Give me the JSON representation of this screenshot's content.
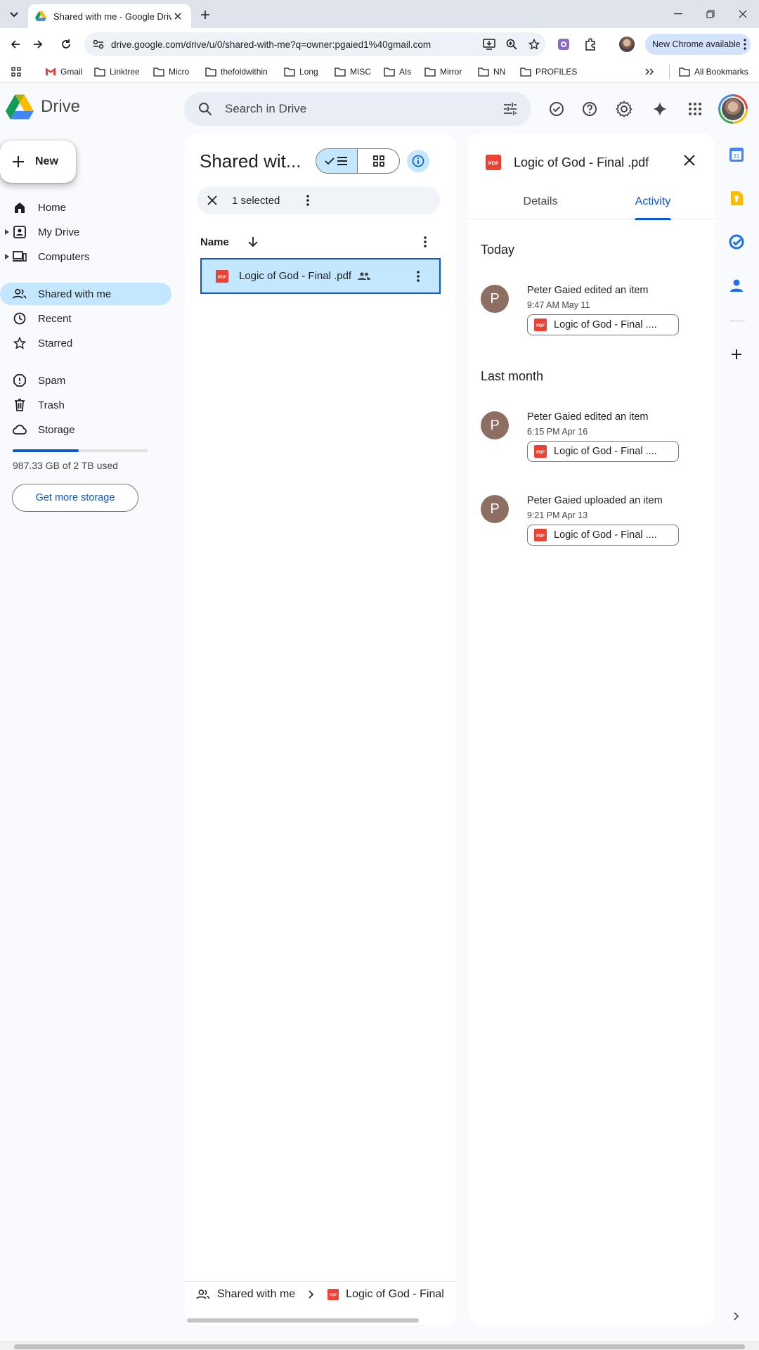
{
  "browser": {
    "tab_title": "Shared with me - Google Drive",
    "url": "drive.google.com/drive/u/0/shared-with-me?q=owner:pgaied1%40gmail.com",
    "update_label": "New Chrome available",
    "bookmarks": [
      "Gmail",
      "Linktree",
      "Micro",
      "thefoldwithin",
      "Long",
      "MISC",
      "AIs",
      "Mirror",
      "NN",
      "PROFILES"
    ],
    "all_bookmarks": "All Bookmarks"
  },
  "drive": {
    "app_name": "Drive",
    "search_placeholder": "Search in Drive"
  },
  "nav": {
    "new_label": "New",
    "items": [
      "Home",
      "My Drive",
      "Computers",
      "Shared with me",
      "Recent",
      "Starred",
      "Spam",
      "Trash",
      "Storage"
    ],
    "active": "Shared with me",
    "storage_text": "987.33 GB of 2 TB used",
    "storage_fraction": 0.49,
    "get_more_storage": "Get more storage"
  },
  "main": {
    "title": "Shared wit...",
    "selected_text": "1 selected",
    "column_name": "Name",
    "files": [
      {
        "name": "Logic of God - Final .pdf",
        "type": "PDF"
      }
    ],
    "breadcrumb": [
      "Shared with me",
      "Logic of God - Final"
    ]
  },
  "panel": {
    "file_name": "Logic of God - Final .pdf",
    "tabs": [
      "Details",
      "Activity"
    ],
    "active_tab": "Activity",
    "groups": [
      {
        "heading": "Today",
        "items": [
          {
            "initial": "P",
            "text": "Peter Gaied edited an item",
            "time": "9:47 AM May 11",
            "file": "Logic of God - Final ...."
          }
        ]
      },
      {
        "heading": "Last month",
        "items": [
          {
            "initial": "P",
            "text": "Peter Gaied edited an item",
            "time": "6:15 PM Apr 16",
            "file": "Logic of God - Final ...."
          },
          {
            "initial": "P",
            "text": "Peter Gaied uploaded an item",
            "time": "9:21 PM Apr 13",
            "file": "Logic of God - Final ...."
          }
        ]
      }
    ]
  },
  "colors": {
    "accent": "#0b57d0",
    "selected_bg": "#c2e7ff",
    "pdf_red": "#ea4335",
    "avatar": "#8d6e63"
  }
}
